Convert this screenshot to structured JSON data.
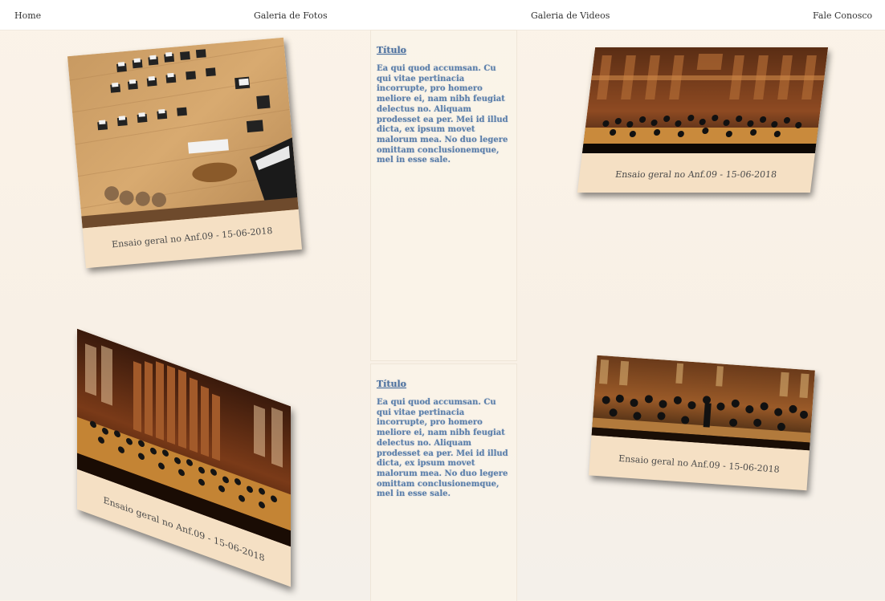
{
  "nav": {
    "home": "Home",
    "photos": "Galeria de Fotos",
    "videos": "Galeria de Videos",
    "contact": "Fale Conosco"
  },
  "cards": [
    {
      "caption": "Ensaio geral no Anf.09 - 15-06-2018",
      "photo": "empty-orchestra-stage-photo"
    },
    {
      "caption": "Ensaio geral no Anf.09 - 15-06-2018",
      "photo": "orchestra-concert-hall-photo"
    },
    {
      "caption": "Ensaio geral no Anf.09 - 15-06-2018",
      "photo": "orchestra-pipe-organ-hall-photo"
    },
    {
      "caption": "Ensaio geral no Anf.09 - 15-06-2018",
      "photo": "orchestra-performance-photo"
    }
  ],
  "articles": [
    {
      "title": "Título",
      "body": "Ea qui quod accumsan. Cu qui vitae pertinacia incorrupte, pro homero meliore ei, nam nibh feugiat delectus no. Aliquam prodesset ea per. Mei id illud dicta, ex ipsum movet malorum mea. No duo legere omittam conclusionemque, mel in esse sale."
    },
    {
      "title": "Título",
      "body": "Ea qui quod accumsan. Cu qui vitae pertinacia incorrupte, pro homero meliore ei, nam nibh feugiat delectus no. Aliquam prodesset ea per. Mei id illud dicta, ex ipsum movet malorum mea. No duo legere omittam conclusionemque, mel in esse sale."
    }
  ],
  "colors": {
    "caption_bg": "#f5e0c4",
    "link_blue": "#4b6f9e",
    "page_bg": "#fbf3e8"
  }
}
